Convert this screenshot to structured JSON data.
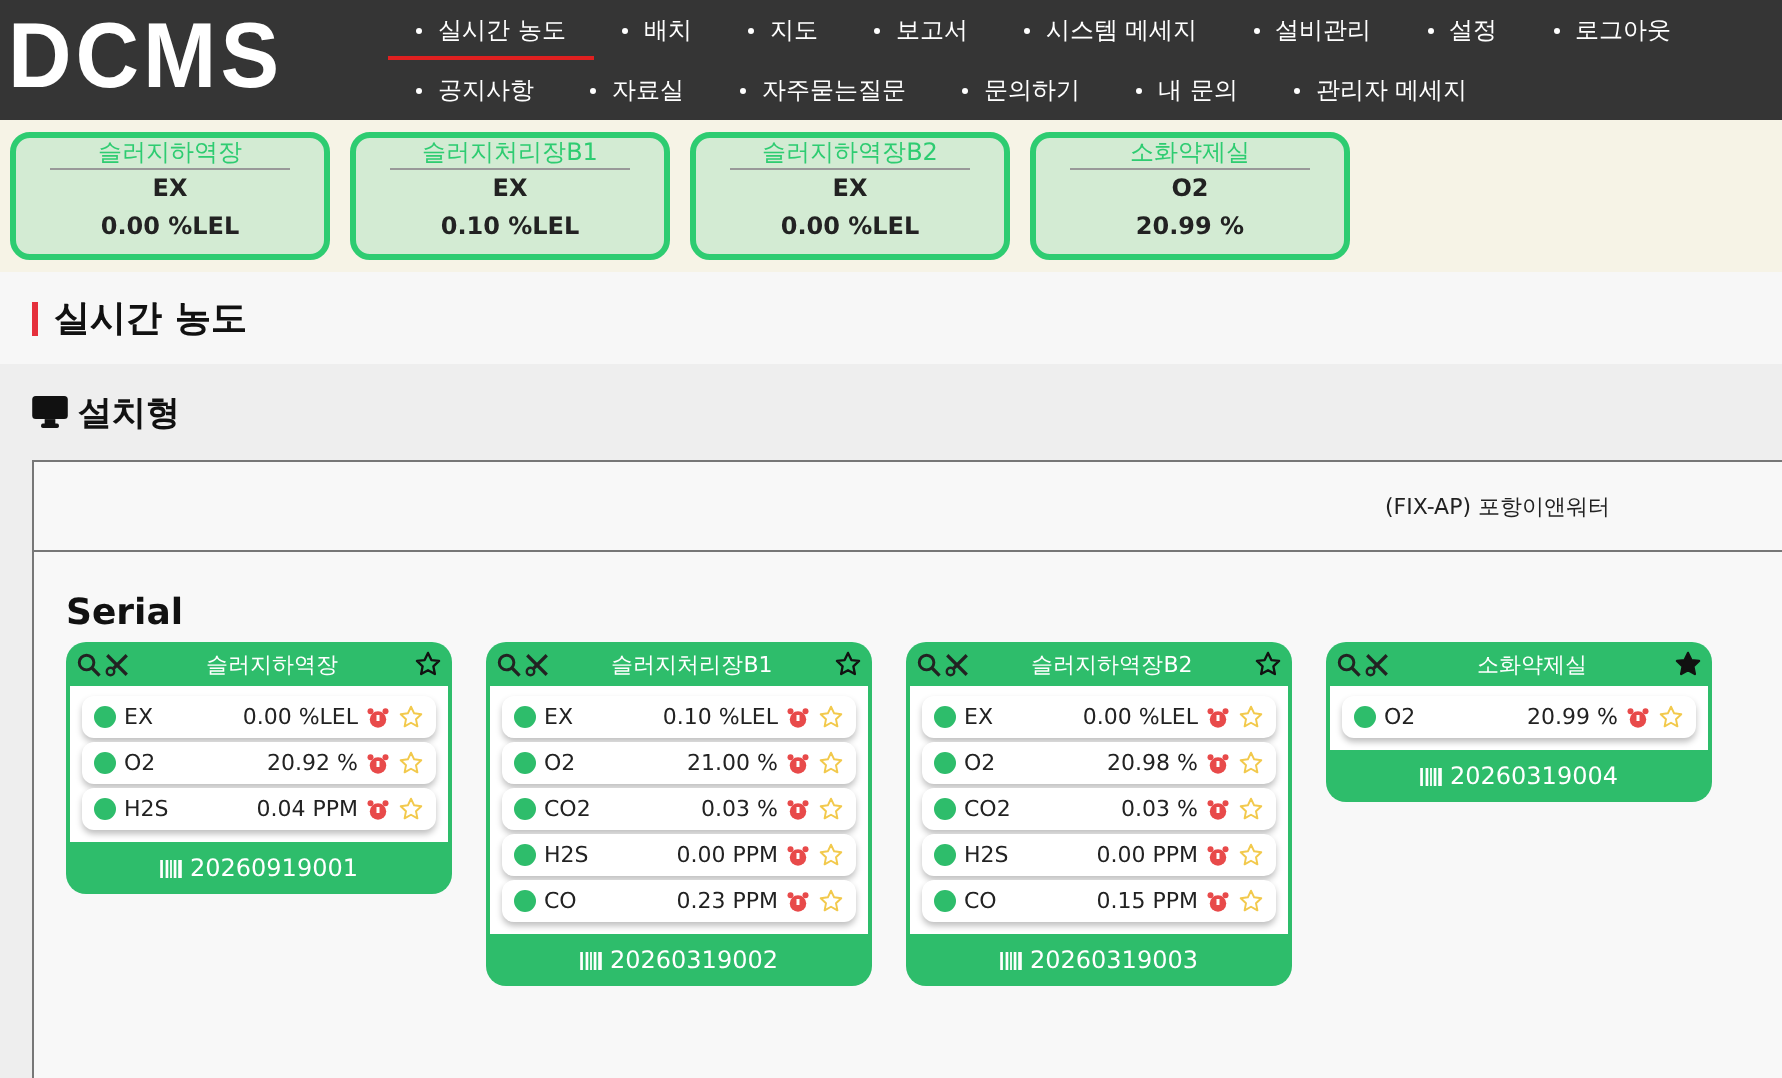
{
  "logo": "DCMS",
  "nav": {
    "rows": [
      [
        {
          "label": "실시간 농도",
          "selected": true
        },
        {
          "label": "배치",
          "selected": false
        },
        {
          "label": "지도",
          "selected": false
        },
        {
          "label": "보고서",
          "selected": false
        },
        {
          "label": "시스템 메세지",
          "selected": false
        },
        {
          "label": "설비관리",
          "selected": false
        },
        {
          "label": "설정",
          "selected": false
        },
        {
          "label": "로그아웃",
          "selected": false
        }
      ],
      [
        {
          "label": "공지사항",
          "selected": false
        },
        {
          "label": "자료실",
          "selected": false
        },
        {
          "label": "자주묻는질문",
          "selected": false
        },
        {
          "label": "문의하기",
          "selected": false
        },
        {
          "label": "내 문의",
          "selected": false
        },
        {
          "label": "관리자 메세지",
          "selected": false
        }
      ]
    ]
  },
  "summary": [
    {
      "name": "슬러지하역장",
      "gas": "EX",
      "value": "0.00 %LEL"
    },
    {
      "name": "슬러지처리장B1",
      "gas": "EX",
      "value": "0.10 %LEL"
    },
    {
      "name": "슬러지하역장B2",
      "gas": "EX",
      "value": "0.00 %LEL"
    },
    {
      "name": "소화약제실",
      "gas": "O2",
      "value": "20.99 %"
    }
  ],
  "page_title": "실시간 농도",
  "section_title": "설치형",
  "site": "(FIX-AP) 포항이앤워터",
  "group_title": "Serial",
  "devices": [
    {
      "name": "슬러지하역장",
      "favorite": false,
      "serial": "20260919001",
      "sensors": [
        {
          "gas": "EX",
          "value": "0.00 %LEL"
        },
        {
          "gas": "O2",
          "value": "20.92 %"
        },
        {
          "gas": "H2S",
          "value": "0.04 PPM"
        }
      ]
    },
    {
      "name": "슬러지처리장B1",
      "favorite": false,
      "serial": "20260319002",
      "sensors": [
        {
          "gas": "EX",
          "value": "0.10 %LEL"
        },
        {
          "gas": "O2",
          "value": "21.00 %"
        },
        {
          "gas": "CO2",
          "value": "0.03 %"
        },
        {
          "gas": "H2S",
          "value": "0.00 PPM"
        },
        {
          "gas": "CO",
          "value": "0.23 PPM"
        }
      ]
    },
    {
      "name": "슬러지하역장B2",
      "favorite": false,
      "serial": "20260319003",
      "sensors": [
        {
          "gas": "EX",
          "value": "0.00 %LEL"
        },
        {
          "gas": "O2",
          "value": "20.98 %"
        },
        {
          "gas": "CO2",
          "value": "0.03 %"
        },
        {
          "gas": "H2S",
          "value": "0.00 PPM"
        },
        {
          "gas": "CO",
          "value": "0.15 PPM"
        }
      ]
    },
    {
      "name": "소화약제실",
      "favorite": true,
      "serial": "20260319004",
      "sensors": [
        {
          "gas": "O2",
          "value": "20.99 %"
        }
      ]
    }
  ]
}
